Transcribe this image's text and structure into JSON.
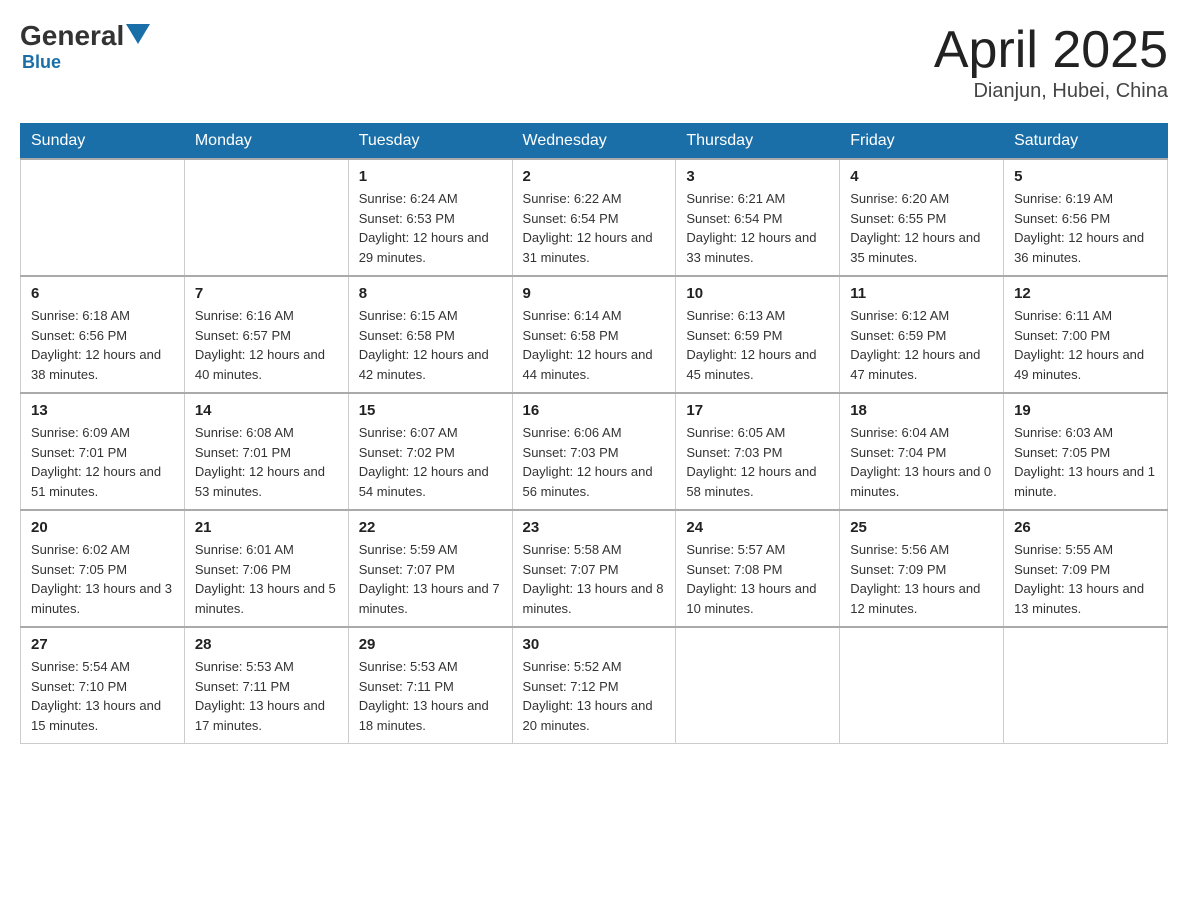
{
  "header": {
    "logo_general": "General",
    "logo_blue": "Blue",
    "month_title": "April 2025",
    "location": "Dianjun, Hubei, China"
  },
  "days_of_week": [
    "Sunday",
    "Monday",
    "Tuesday",
    "Wednesday",
    "Thursday",
    "Friday",
    "Saturday"
  ],
  "weeks": [
    [
      {
        "day": "",
        "sunrise": "",
        "sunset": "",
        "daylight": ""
      },
      {
        "day": "",
        "sunrise": "",
        "sunset": "",
        "daylight": ""
      },
      {
        "day": "1",
        "sunrise": "Sunrise: 6:24 AM",
        "sunset": "Sunset: 6:53 PM",
        "daylight": "Daylight: 12 hours and 29 minutes."
      },
      {
        "day": "2",
        "sunrise": "Sunrise: 6:22 AM",
        "sunset": "Sunset: 6:54 PM",
        "daylight": "Daylight: 12 hours and 31 minutes."
      },
      {
        "day": "3",
        "sunrise": "Sunrise: 6:21 AM",
        "sunset": "Sunset: 6:54 PM",
        "daylight": "Daylight: 12 hours and 33 minutes."
      },
      {
        "day": "4",
        "sunrise": "Sunrise: 6:20 AM",
        "sunset": "Sunset: 6:55 PM",
        "daylight": "Daylight: 12 hours and 35 minutes."
      },
      {
        "day": "5",
        "sunrise": "Sunrise: 6:19 AM",
        "sunset": "Sunset: 6:56 PM",
        "daylight": "Daylight: 12 hours and 36 minutes."
      }
    ],
    [
      {
        "day": "6",
        "sunrise": "Sunrise: 6:18 AM",
        "sunset": "Sunset: 6:56 PM",
        "daylight": "Daylight: 12 hours and 38 minutes."
      },
      {
        "day": "7",
        "sunrise": "Sunrise: 6:16 AM",
        "sunset": "Sunset: 6:57 PM",
        "daylight": "Daylight: 12 hours and 40 minutes."
      },
      {
        "day": "8",
        "sunrise": "Sunrise: 6:15 AM",
        "sunset": "Sunset: 6:58 PM",
        "daylight": "Daylight: 12 hours and 42 minutes."
      },
      {
        "day": "9",
        "sunrise": "Sunrise: 6:14 AM",
        "sunset": "Sunset: 6:58 PM",
        "daylight": "Daylight: 12 hours and 44 minutes."
      },
      {
        "day": "10",
        "sunrise": "Sunrise: 6:13 AM",
        "sunset": "Sunset: 6:59 PM",
        "daylight": "Daylight: 12 hours and 45 minutes."
      },
      {
        "day": "11",
        "sunrise": "Sunrise: 6:12 AM",
        "sunset": "Sunset: 6:59 PM",
        "daylight": "Daylight: 12 hours and 47 minutes."
      },
      {
        "day": "12",
        "sunrise": "Sunrise: 6:11 AM",
        "sunset": "Sunset: 7:00 PM",
        "daylight": "Daylight: 12 hours and 49 minutes."
      }
    ],
    [
      {
        "day": "13",
        "sunrise": "Sunrise: 6:09 AM",
        "sunset": "Sunset: 7:01 PM",
        "daylight": "Daylight: 12 hours and 51 minutes."
      },
      {
        "day": "14",
        "sunrise": "Sunrise: 6:08 AM",
        "sunset": "Sunset: 7:01 PM",
        "daylight": "Daylight: 12 hours and 53 minutes."
      },
      {
        "day": "15",
        "sunrise": "Sunrise: 6:07 AM",
        "sunset": "Sunset: 7:02 PM",
        "daylight": "Daylight: 12 hours and 54 minutes."
      },
      {
        "day": "16",
        "sunrise": "Sunrise: 6:06 AM",
        "sunset": "Sunset: 7:03 PM",
        "daylight": "Daylight: 12 hours and 56 minutes."
      },
      {
        "day": "17",
        "sunrise": "Sunrise: 6:05 AM",
        "sunset": "Sunset: 7:03 PM",
        "daylight": "Daylight: 12 hours and 58 minutes."
      },
      {
        "day": "18",
        "sunrise": "Sunrise: 6:04 AM",
        "sunset": "Sunset: 7:04 PM",
        "daylight": "Daylight: 13 hours and 0 minutes."
      },
      {
        "day": "19",
        "sunrise": "Sunrise: 6:03 AM",
        "sunset": "Sunset: 7:05 PM",
        "daylight": "Daylight: 13 hours and 1 minute."
      }
    ],
    [
      {
        "day": "20",
        "sunrise": "Sunrise: 6:02 AM",
        "sunset": "Sunset: 7:05 PM",
        "daylight": "Daylight: 13 hours and 3 minutes."
      },
      {
        "day": "21",
        "sunrise": "Sunrise: 6:01 AM",
        "sunset": "Sunset: 7:06 PM",
        "daylight": "Daylight: 13 hours and 5 minutes."
      },
      {
        "day": "22",
        "sunrise": "Sunrise: 5:59 AM",
        "sunset": "Sunset: 7:07 PM",
        "daylight": "Daylight: 13 hours and 7 minutes."
      },
      {
        "day": "23",
        "sunrise": "Sunrise: 5:58 AM",
        "sunset": "Sunset: 7:07 PM",
        "daylight": "Daylight: 13 hours and 8 minutes."
      },
      {
        "day": "24",
        "sunrise": "Sunrise: 5:57 AM",
        "sunset": "Sunset: 7:08 PM",
        "daylight": "Daylight: 13 hours and 10 minutes."
      },
      {
        "day": "25",
        "sunrise": "Sunrise: 5:56 AM",
        "sunset": "Sunset: 7:09 PM",
        "daylight": "Daylight: 13 hours and 12 minutes."
      },
      {
        "day": "26",
        "sunrise": "Sunrise: 5:55 AM",
        "sunset": "Sunset: 7:09 PM",
        "daylight": "Daylight: 13 hours and 13 minutes."
      }
    ],
    [
      {
        "day": "27",
        "sunrise": "Sunrise: 5:54 AM",
        "sunset": "Sunset: 7:10 PM",
        "daylight": "Daylight: 13 hours and 15 minutes."
      },
      {
        "day": "28",
        "sunrise": "Sunrise: 5:53 AM",
        "sunset": "Sunset: 7:11 PM",
        "daylight": "Daylight: 13 hours and 17 minutes."
      },
      {
        "day": "29",
        "sunrise": "Sunrise: 5:53 AM",
        "sunset": "Sunset: 7:11 PM",
        "daylight": "Daylight: 13 hours and 18 minutes."
      },
      {
        "day": "30",
        "sunrise": "Sunrise: 5:52 AM",
        "sunset": "Sunset: 7:12 PM",
        "daylight": "Daylight: 13 hours and 20 minutes."
      },
      {
        "day": "",
        "sunrise": "",
        "sunset": "",
        "daylight": ""
      },
      {
        "day": "",
        "sunrise": "",
        "sunset": "",
        "daylight": ""
      },
      {
        "day": "",
        "sunrise": "",
        "sunset": "",
        "daylight": ""
      }
    ]
  ]
}
